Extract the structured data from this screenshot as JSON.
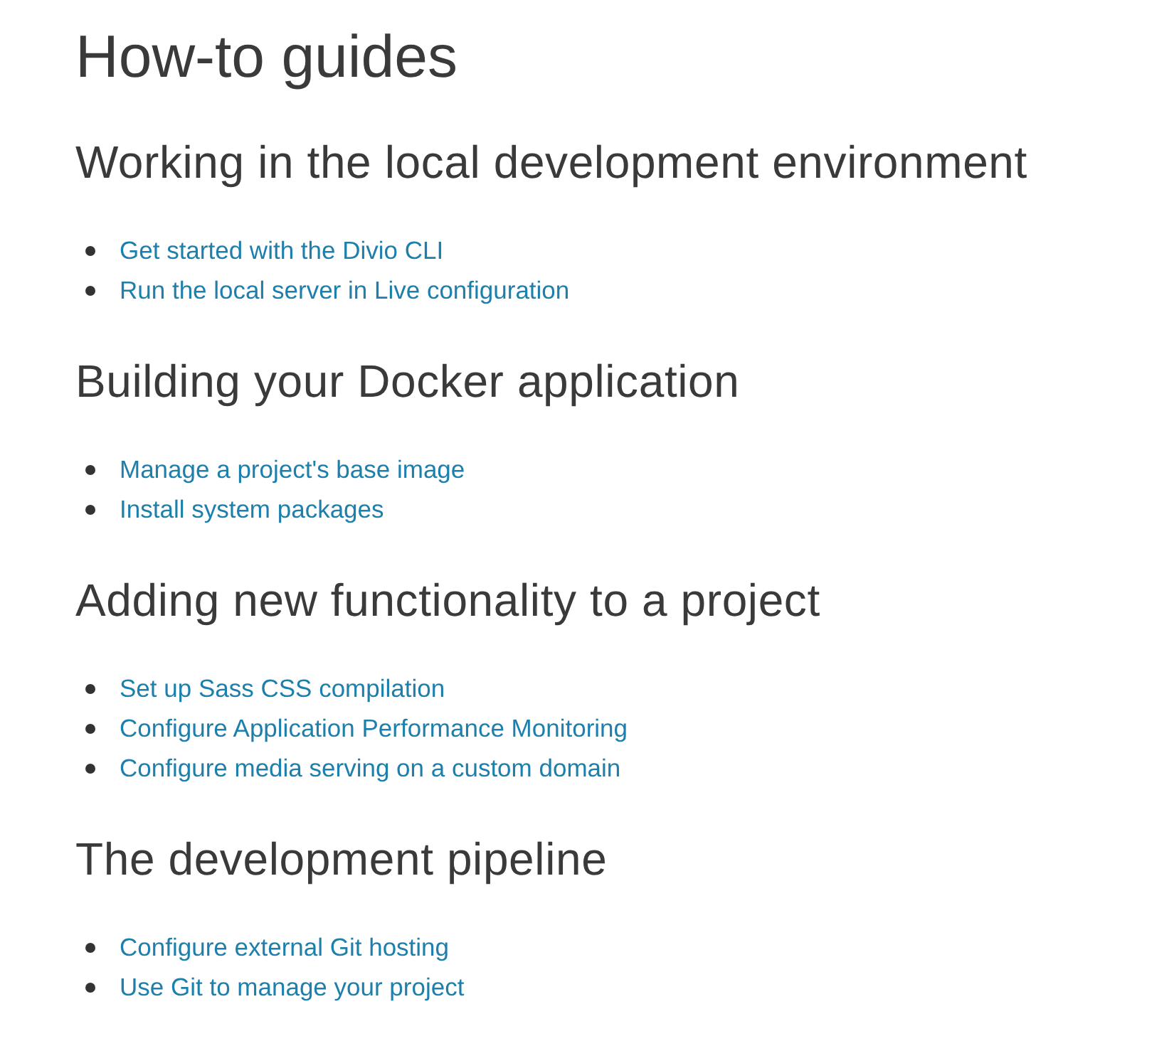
{
  "title": "How-to guides",
  "sections": [
    {
      "heading": "Working in the local development environment",
      "links": [
        "Get started with the Divio CLI",
        "Run the local server in Live configuration"
      ]
    },
    {
      "heading": "Building your Docker application",
      "links": [
        "Manage a project's base image",
        "Install system packages"
      ]
    },
    {
      "heading": "Adding new functionality to a project",
      "links": [
        "Set up Sass CSS compilation",
        "Configure Application Performance Monitoring",
        "Configure media serving on a custom domain"
      ]
    },
    {
      "heading": "The development pipeline",
      "links": [
        "Configure external Git hosting",
        "Use Git to manage your project"
      ]
    }
  ]
}
